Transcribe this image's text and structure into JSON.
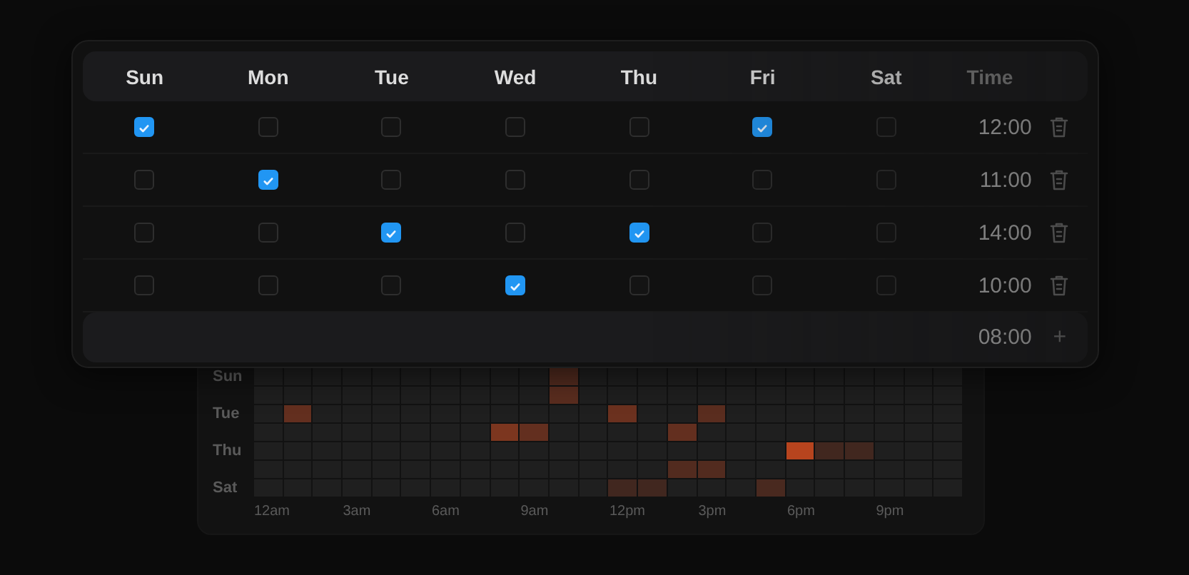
{
  "heatmap": {
    "rows": [
      {
        "label": "Sun",
        "cells": [
          {
            "color": "#1f1f1f"
          },
          {
            "color": "#1f1f1f"
          },
          {
            "color": "#1f1f1f"
          },
          {
            "color": "#1f1f1f"
          },
          {
            "color": "#1f1f1f"
          },
          {
            "color": "#1f1f1f"
          },
          {
            "color": "#1f1f1f"
          },
          {
            "color": "#1f1f1f"
          },
          {
            "color": "#1f1f1f"
          },
          {
            "color": "#1f1f1f"
          },
          {
            "color": "#522b1f"
          },
          {
            "color": "#1f1f1f"
          },
          {
            "color": "#1f1f1f"
          },
          {
            "color": "#1f1f1f"
          },
          {
            "color": "#1f1f1f"
          },
          {
            "color": "#1f1f1f"
          },
          {
            "color": "#1f1f1f"
          },
          {
            "color": "#1f1f1f"
          },
          {
            "color": "#1f1f1f"
          },
          {
            "color": "#1f1f1f"
          },
          {
            "color": "#1f1f1f"
          },
          {
            "color": "#1f1f1f"
          },
          {
            "color": "#1f1f1f"
          },
          {
            "color": "#1f1f1f"
          }
        ]
      },
      {
        "cells": [
          {
            "color": "#1f1f1f"
          },
          {
            "color": "#1f1f1f"
          },
          {
            "color": "#1f1f1f"
          },
          {
            "color": "#1f1f1f"
          },
          {
            "color": "#1f1f1f"
          },
          {
            "color": "#1f1f1f"
          },
          {
            "color": "#1f1f1f"
          },
          {
            "color": "#1f1f1f"
          },
          {
            "color": "#1f1f1f"
          },
          {
            "color": "#1f1f1f"
          },
          {
            "color": "#5a2d1f"
          },
          {
            "color": "#1f1f1f"
          },
          {
            "color": "#1f1f1f"
          },
          {
            "color": "#1f1f1f"
          },
          {
            "color": "#1f1f1f"
          },
          {
            "color": "#1f1f1f"
          },
          {
            "color": "#1f1f1f"
          },
          {
            "color": "#1f1f1f"
          },
          {
            "color": "#1f1f1f"
          },
          {
            "color": "#1f1f1f"
          },
          {
            "color": "#1f1f1f"
          },
          {
            "color": "#1f1f1f"
          },
          {
            "color": "#1f1f1f"
          },
          {
            "color": "#1f1f1f"
          }
        ]
      },
      {
        "label": "Tue",
        "cells": [
          {
            "color": "#1f1f1f"
          },
          {
            "color": "#632f1f"
          },
          {
            "color": "#1f1f1f"
          },
          {
            "color": "#1f1f1f"
          },
          {
            "color": "#1f1f1f"
          },
          {
            "color": "#1f1f1f"
          },
          {
            "color": "#1f1f1f"
          },
          {
            "color": "#1f1f1f"
          },
          {
            "color": "#1f1f1f"
          },
          {
            "color": "#1f1f1f"
          },
          {
            "color": "#1f1f1f"
          },
          {
            "color": "#1f1f1f"
          },
          {
            "color": "#6b311f"
          },
          {
            "color": "#1f1f1f"
          },
          {
            "color": "#1f1f1f"
          },
          {
            "color": "#5a2d1f"
          },
          {
            "color": "#1f1f1f"
          },
          {
            "color": "#1f1f1f"
          },
          {
            "color": "#1f1f1f"
          },
          {
            "color": "#1f1f1f"
          },
          {
            "color": "#1f1f1f"
          },
          {
            "color": "#1f1f1f"
          },
          {
            "color": "#1f1f1f"
          },
          {
            "color": "#1f1f1f"
          }
        ]
      },
      {
        "cells": [
          {
            "color": "#1f1f1f"
          },
          {
            "color": "#1f1f1f"
          },
          {
            "color": "#1f1f1f"
          },
          {
            "color": "#1f1f1f"
          },
          {
            "color": "#1f1f1f"
          },
          {
            "color": "#1f1f1f"
          },
          {
            "color": "#1f1f1f"
          },
          {
            "color": "#1f1f1f"
          },
          {
            "color": "#7c361f"
          },
          {
            "color": "#632f1f"
          },
          {
            "color": "#1f1f1f"
          },
          {
            "color": "#1f1f1f"
          },
          {
            "color": "#1f1f1f"
          },
          {
            "color": "#1f1f1f"
          },
          {
            "color": "#632f1f"
          },
          {
            "color": "#1f1f1f"
          },
          {
            "color": "#1f1f1f"
          },
          {
            "color": "#1f1f1f"
          },
          {
            "color": "#1f1f1f"
          },
          {
            "color": "#1f1f1f"
          },
          {
            "color": "#1f1f1f"
          },
          {
            "color": "#1f1f1f"
          },
          {
            "color": "#1f1f1f"
          },
          {
            "color": "#1f1f1f"
          }
        ]
      },
      {
        "label": "Thu",
        "cells": [
          {
            "color": "#1f1f1f"
          },
          {
            "color": "#1f1f1f"
          },
          {
            "color": "#1f1f1f"
          },
          {
            "color": "#1f1f1f"
          },
          {
            "color": "#1f1f1f"
          },
          {
            "color": "#1f1f1f"
          },
          {
            "color": "#1f1f1f"
          },
          {
            "color": "#1f1f1f"
          },
          {
            "color": "#1f1f1f"
          },
          {
            "color": "#1f1f1f"
          },
          {
            "color": "#1f1f1f"
          },
          {
            "color": "#1f1f1f"
          },
          {
            "color": "#1f1f1f"
          },
          {
            "color": "#1f1f1f"
          },
          {
            "color": "#1f1f1f"
          },
          {
            "color": "#1f1f1f"
          },
          {
            "color": "#1f1f1f"
          },
          {
            "color": "#1f1f1f"
          },
          {
            "color": "#b7441e"
          },
          {
            "color": "#41271f"
          },
          {
            "color": "#41271f"
          },
          {
            "color": "#1f1f1f"
          },
          {
            "color": "#1f1f1f"
          },
          {
            "color": "#1f1f1f"
          }
        ]
      },
      {
        "cells": [
          {
            "color": "#1f1f1f"
          },
          {
            "color": "#1f1f1f"
          },
          {
            "color": "#1f1f1f"
          },
          {
            "color": "#1f1f1f"
          },
          {
            "color": "#1f1f1f"
          },
          {
            "color": "#1f1f1f"
          },
          {
            "color": "#1f1f1f"
          },
          {
            "color": "#1f1f1f"
          },
          {
            "color": "#1f1f1f"
          },
          {
            "color": "#1f1f1f"
          },
          {
            "color": "#1f1f1f"
          },
          {
            "color": "#1f1f1f"
          },
          {
            "color": "#1f1f1f"
          },
          {
            "color": "#1f1f1f"
          },
          {
            "color": "#522b1f"
          },
          {
            "color": "#522b1f"
          },
          {
            "color": "#1f1f1f"
          },
          {
            "color": "#1f1f1f"
          },
          {
            "color": "#1f1f1f"
          },
          {
            "color": "#1f1f1f"
          },
          {
            "color": "#1f1f1f"
          },
          {
            "color": "#1f1f1f"
          },
          {
            "color": "#1f1f1f"
          },
          {
            "color": "#1f1f1f"
          }
        ]
      },
      {
        "label": "Sat",
        "cells": [
          {
            "color": "#1f1f1f"
          },
          {
            "color": "#1f1f1f"
          },
          {
            "color": "#1f1f1f"
          },
          {
            "color": "#1f1f1f"
          },
          {
            "color": "#1f1f1f"
          },
          {
            "color": "#1f1f1f"
          },
          {
            "color": "#1f1f1f"
          },
          {
            "color": "#1f1f1f"
          },
          {
            "color": "#1f1f1f"
          },
          {
            "color": "#1f1f1f"
          },
          {
            "color": "#1f1f1f"
          },
          {
            "color": "#1f1f1f"
          },
          {
            "color": "#41271f"
          },
          {
            "color": "#41271f"
          },
          {
            "color": "#1f1f1f"
          },
          {
            "color": "#1f1f1f"
          },
          {
            "color": "#1f1f1f"
          },
          {
            "color": "#49291f"
          },
          {
            "color": "#1f1f1f"
          },
          {
            "color": "#1f1f1f"
          },
          {
            "color": "#1f1f1f"
          },
          {
            "color": "#1f1f1f"
          },
          {
            "color": "#1f1f1f"
          },
          {
            "color": "#1f1f1f"
          }
        ]
      }
    ],
    "hours": [
      "12am",
      "3am",
      "6am",
      "9am",
      "12pm",
      "3pm",
      "6pm",
      "9pm"
    ]
  },
  "schedule": {
    "columns": [
      "Sun",
      "Mon",
      "Tue",
      "Wed",
      "Thu",
      "Fri",
      "Sat"
    ],
    "time_header": "Time",
    "rows": [
      {
        "days": [
          {
            "checked": true
          },
          {
            "checked": false
          },
          {
            "checked": false
          },
          {
            "checked": false
          },
          {
            "checked": false
          },
          {
            "checked": true
          },
          {
            "checked": false
          }
        ],
        "time": "12:00"
      },
      {
        "days": [
          {
            "checked": false
          },
          {
            "checked": true
          },
          {
            "checked": false
          },
          {
            "checked": false
          },
          {
            "checked": false
          },
          {
            "checked": false
          },
          {
            "checked": false
          }
        ],
        "time": "11:00"
      },
      {
        "days": [
          {
            "checked": false
          },
          {
            "checked": false
          },
          {
            "checked": true
          },
          {
            "checked": false
          },
          {
            "checked": true
          },
          {
            "checked": false
          },
          {
            "checked": false
          }
        ],
        "time": "14:00"
      },
      {
        "days": [
          {
            "checked": false
          },
          {
            "checked": false
          },
          {
            "checked": false
          },
          {
            "checked": true
          },
          {
            "checked": false
          },
          {
            "checked": false
          },
          {
            "checked": false
          }
        ],
        "time": "10:00"
      }
    ],
    "new_row": {
      "time": "08:00",
      "add": "+"
    }
  }
}
